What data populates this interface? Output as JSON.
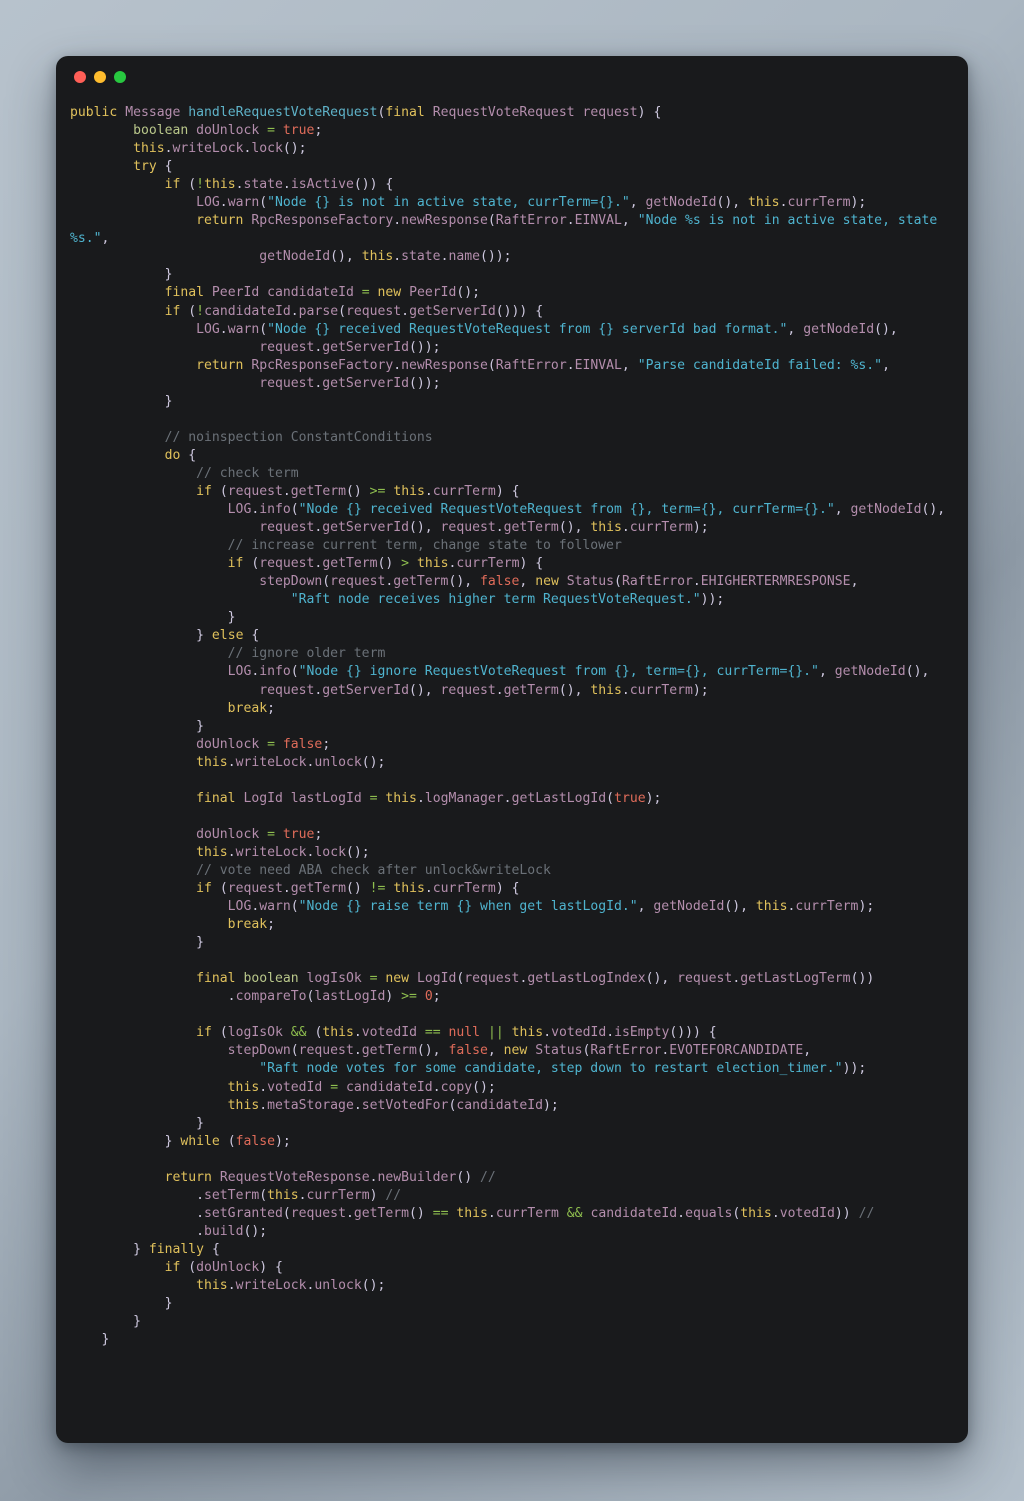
{
  "window": {
    "traffic_lights": [
      {
        "name": "close-button",
        "color": "#ff5f57"
      },
      {
        "name": "minimize-button",
        "color": "#febc2e"
      },
      {
        "name": "maximize-button",
        "color": "#28c840"
      }
    ],
    "background_color": "#191a1c",
    "desktop_background_color": "#aab6c1"
  },
  "theme": {
    "keyword": "#e0c15c",
    "type": "#b48ead",
    "function": "#5fb3c9",
    "identifier": "#b48ead",
    "string": "#4fb4cf",
    "number": "#e06c5a",
    "comment": "#6b7178",
    "operator": "#8fbf4f",
    "primitive": "#b9c78a",
    "punctuation": "#cfc9e0"
  },
  "code": {
    "language": "java",
    "full_text": "public Message handleRequestVoteRequest(final RequestVoteRequest request) {\n        boolean doUnlock = true;\n        this.writeLock.lock();\n        try {\n            if (!this.state.isActive()) {\n                LOG.warn(\"Node {} is not in active state, currTerm={}.\", getNodeId(), this.currTerm);\n                return RpcResponseFactory.newResponse(RaftError.EINVAL, \"Node %s is not in active state, state %s.\",\n                        getNodeId(), this.state.name());\n            }\n            final PeerId candidateId = new PeerId();\n            if (!candidateId.parse(request.getServerId())) {\n                LOG.warn(\"Node {} received RequestVoteRequest from {} serverId bad format.\", getNodeId(),\n                        request.getServerId());\n                return RpcResponseFactory.newResponse(RaftError.EINVAL, \"Parse candidateId failed: %s.\",\n                        request.getServerId());\n            }\n\n            // noinspection ConstantConditions\n            do {\n                // check term\n                if (request.getTerm() >= this.currTerm) {\n                    LOG.info(\"Node {} received RequestVoteRequest from {}, term={}, currTerm={}.\", getNodeId(),\n                        request.getServerId(), request.getTerm(), this.currTerm);\n                    // increase current term, change state to follower\n                    if (request.getTerm() > this.currTerm) {\n                        stepDown(request.getTerm(), false, new Status(RaftError.EHIGHERTERMRESPONSE,\n                            \"Raft node receives higher term RequestVoteRequest.\"));\n                    }\n                } else {\n                    // ignore older term\n                    LOG.info(\"Node {} ignore RequestVoteRequest from {}, term={}, currTerm={}.\", getNodeId(),\n                        request.getServerId(), request.getTerm(), this.currTerm);\n                    break;\n                }\n                doUnlock = false;\n                this.writeLock.unlock();\n\n                final LogId lastLogId = this.logManager.getLastLogId(true);\n\n                doUnlock = true;\n                this.writeLock.lock();\n                // vote need ABA check after unlock&writeLock\n                if (request.getTerm() != this.currTerm) {\n                    LOG.warn(\"Node {} raise term {} when get lastLogId.\", getNodeId(), this.currTerm);\n                    break;\n                }\n\n                final boolean logIsOk = new LogId(request.getLastLogIndex(), request.getLastLogTerm())\n                    .compareTo(lastLogId) >= 0;\n\n                if (logIsOk && (this.votedId == null || this.votedId.isEmpty())) {\n                    stepDown(request.getTerm(), false, new Status(RaftError.EVOTEFORCANDIDATE,\n                        \"Raft node votes for some candidate, step down to restart election_timer.\"));\n                    this.votedId = candidateId.copy();\n                    this.metaStorage.setVotedFor(candidateId);\n                }\n            } while (false);\n\n            return RequestVoteResponse.newBuilder() //\n                .setTerm(this.currTerm) //\n                .setGranted(request.getTerm() == this.currTerm && candidateId.equals(this.votedId)) //\n                .build();\n        } finally {\n            if (doUnlock) {\n                this.writeLock.unlock();\n            }\n        }\n    }"
  }
}
